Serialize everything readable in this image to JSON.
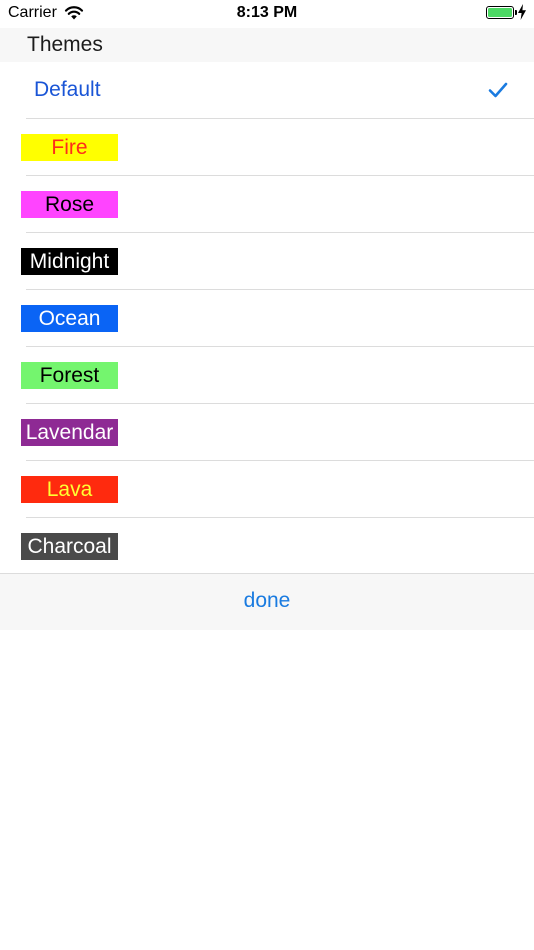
{
  "status_bar": {
    "carrier": "Carrier",
    "time": "8:13 PM",
    "battery_color": "#4cd964"
  },
  "section": {
    "title": "Themes"
  },
  "themes": [
    {
      "label": "Default",
      "selected": true,
      "text_color": "#1a55d6"
    },
    {
      "label": "Fire",
      "bg": "#ffff00",
      "fg": "#ff2d1a"
    },
    {
      "label": "Rose",
      "bg": "#ff44ff",
      "fg": "#000000"
    },
    {
      "label": "Midnight",
      "bg": "#000000",
      "fg": "#ffffff"
    },
    {
      "label": "Ocean",
      "bg": "#0a64f5",
      "fg": "#ffffff"
    },
    {
      "label": "Forest",
      "bg": "#74f56e",
      "fg": "#000000"
    },
    {
      "label": "Lavendar",
      "bg": "#8e2a94",
      "fg": "#ffffff"
    },
    {
      "label": "Lava",
      "bg": "#ff2a0e",
      "fg": "#ffff33"
    },
    {
      "label": "Charcoal",
      "bg": "#4a4a4a",
      "fg": "#ffffff"
    }
  ],
  "footer": {
    "done_label": "done",
    "accent": "#1a7be0"
  },
  "check_color": "#1a7be0"
}
